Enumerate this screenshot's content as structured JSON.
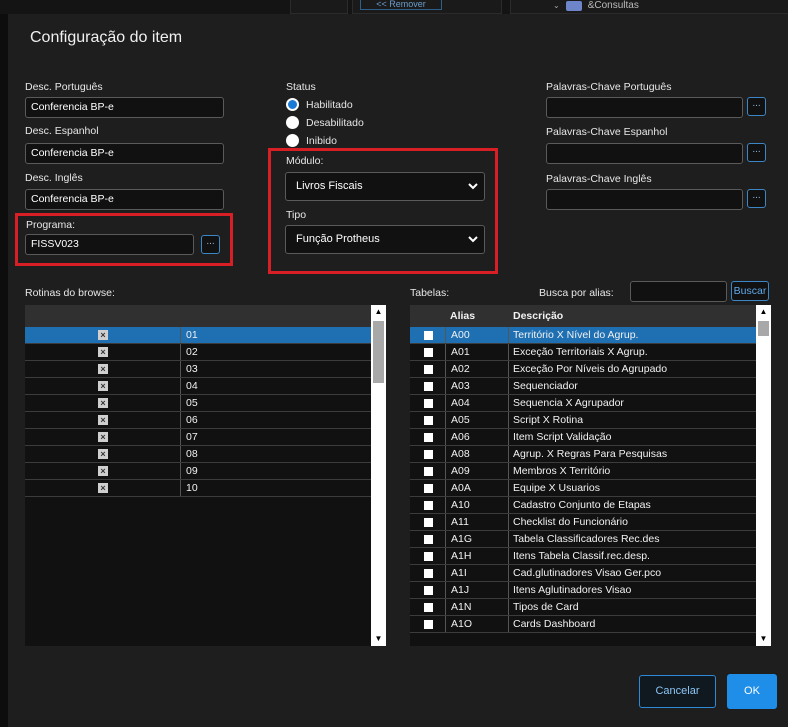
{
  "background": {
    "remover_label": "<< Remover",
    "tree_item_label": "&Consultas"
  },
  "dialog": {
    "title": "Configuração do item",
    "desc": {
      "pt_label": "Desc. Português",
      "pt_value": "Conferencia BP-e",
      "es_label": "Desc. Espanhol",
      "es_value": "Conferencia BP-e",
      "en_label": "Desc. Inglês",
      "en_value": "Conferencia BP-e"
    },
    "programa": {
      "label": "Programa:",
      "value": "FISSV023",
      "button": "..."
    },
    "status": {
      "label": "Status",
      "options": [
        {
          "label": "Habilitado",
          "selected": true
        },
        {
          "label": "Desabilitado",
          "selected": false
        },
        {
          "label": "Inibido",
          "selected": false
        }
      ]
    },
    "modulo": {
      "label": "Módulo:",
      "value": "Livros Fiscais"
    },
    "tipo": {
      "label": "Tipo",
      "value": "Função Protheus"
    },
    "keywords": {
      "pt_label": "Palavras-Chave Português",
      "es_label": "Palavras-Chave Espanhol",
      "en_label": "Palavras-Chave Inglês",
      "button": "..."
    },
    "rotinas": {
      "label": "Rotinas do browse:",
      "rows": [
        "01",
        "02",
        "03",
        "04",
        "05",
        "06",
        "07",
        "08",
        "09",
        "10"
      ]
    },
    "tabelas": {
      "label": "Tabelas:",
      "search_label": "Busca por alias:",
      "search_button": "Buscar",
      "col_alias": "Alias",
      "col_desc": "Descrição",
      "rows": [
        {
          "alias": "A00",
          "desc": "Território X Nível do Agrup."
        },
        {
          "alias": "A01",
          "desc": "Exceção Territoriais X Agrup."
        },
        {
          "alias": "A02",
          "desc": "Exceção Por Níveis do Agrupado"
        },
        {
          "alias": "A03",
          "desc": "Sequenciador"
        },
        {
          "alias": "A04",
          "desc": "Sequencia X Agrupador"
        },
        {
          "alias": "A05",
          "desc": "Script X Rotina"
        },
        {
          "alias": "A06",
          "desc": "Item Script Validação"
        },
        {
          "alias": "A08",
          "desc": "Agrup. X Regras Para Pesquisas"
        },
        {
          "alias": "A09",
          "desc": "Membros X Território"
        },
        {
          "alias": "A0A",
          "desc": "Equipe X Usuarios"
        },
        {
          "alias": "A10",
          "desc": "Cadastro Conjunto de Etapas"
        },
        {
          "alias": "A11",
          "desc": "Checklist do Funcionário"
        },
        {
          "alias": "A1G",
          "desc": "Tabela Classificadores Rec.des"
        },
        {
          "alias": "A1H",
          "desc": "Itens Tabela Classif.rec.desp."
        },
        {
          "alias": "A1I",
          "desc": "Cad.glutinadores Visao Ger.pco"
        },
        {
          "alias": "A1J",
          "desc": "Itens Aglutinadores Visao"
        },
        {
          "alias": "A1N",
          "desc": "Tipos de Card"
        },
        {
          "alias": "A1O",
          "desc": "Cards Dashboard"
        }
      ]
    },
    "buttons": {
      "cancel": "Cancelar",
      "ok": "OK"
    },
    "colors": {
      "accent": "#1e8ee8",
      "highlight_row": "#1f6fb3",
      "callout": "#d81f26"
    }
  }
}
